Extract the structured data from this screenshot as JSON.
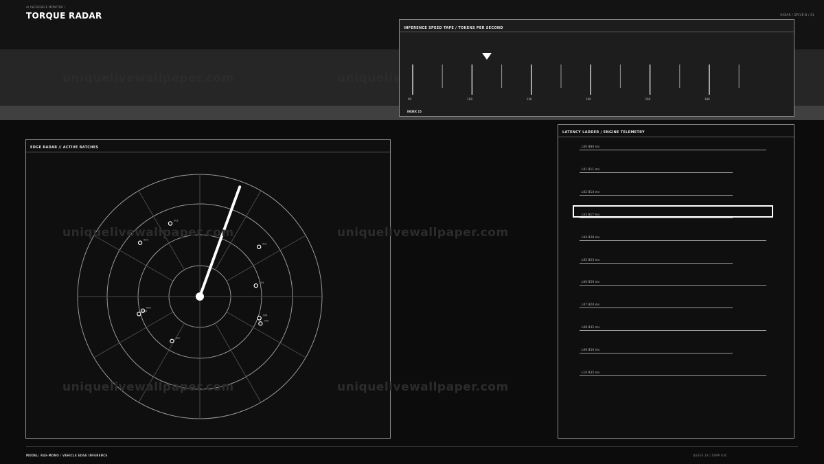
{
  "header": {
    "breadcrumb": "AI INFERENCE MONITOR /",
    "title": "TORQUE RADAR",
    "top_right": "RADAR / DRIVE-D / 01"
  },
  "watermark": "uniquelivewallpaper.com",
  "speed_tape": {
    "title": "INFERENCE SPEED TAPE / TOKENS PER SECOND",
    "index_label": "INDEX 15",
    "marker_value": 115,
    "scale": [
      90,
      100,
      110,
      120,
      130,
      140,
      150,
      160,
      170,
      180,
      190,
      200
    ],
    "tick_labels": [
      "90",
      "100",
      "120",
      "140",
      "160",
      "180"
    ]
  },
  "radar": {
    "title": "EDGE RADAR // ACTIVE BATCHES",
    "sweep_angle_deg": 20,
    "ring_count": 4,
    "points": [
      {
        "label": "002",
        "angle_deg": 338,
        "ring": 2.55
      },
      {
        "label": "003",
        "angle_deg": 312,
        "ring": 2.6
      },
      {
        "label": "001",
        "angle_deg": 50,
        "ring": 2.5
      },
      {
        "label": "004",
        "angle_deg": 79,
        "ring": 1.85
      },
      {
        "label": "005",
        "angle_deg": 256,
        "ring": 1.9
      },
      {
        "label": "006",
        "angle_deg": 254,
        "ring": 2.05
      },
      {
        "label": "008",
        "angle_deg": 110,
        "ring": 2.05
      },
      {
        "label": "009",
        "angle_deg": 114,
        "ring": 2.15
      },
      {
        "label": "007",
        "angle_deg": 212,
        "ring": 1.7
      }
    ]
  },
  "ladder": {
    "title": "LATENCY LADDER / ENGINE TELEMETRY",
    "selected_index": 3,
    "rungs": [
      {
        "label": "L00  880 ms",
        "length": 1.0
      },
      {
        "label": "L01  811 ms",
        "length": 0.82
      },
      {
        "label": "L02  814 ms",
        "length": 0.82
      },
      {
        "label": "L03  817 ms",
        "length": 0.82
      },
      {
        "label": "L04  828 ms",
        "length": 1.0
      },
      {
        "label": "L05  823 ms",
        "length": 0.82
      },
      {
        "label": "L06  850 ms",
        "length": 1.0
      },
      {
        "label": "L07  820 ms",
        "length": 0.82
      },
      {
        "label": "L08  832 ms",
        "length": 1.0
      },
      {
        "label": "L09  850 ms",
        "length": 0.82
      },
      {
        "label": "L10  835 ms",
        "length": 1.0
      }
    ]
  },
  "footer": {
    "left": "MODEL: R43-MONO / VEHICLE EDGE INFERENCE",
    "right": "QUEUE 28  |  TEMP 63C"
  },
  "colors": {
    "background": "#0b0c0b",
    "accent": "#ffffff",
    "line": "#8c8c8c"
  }
}
